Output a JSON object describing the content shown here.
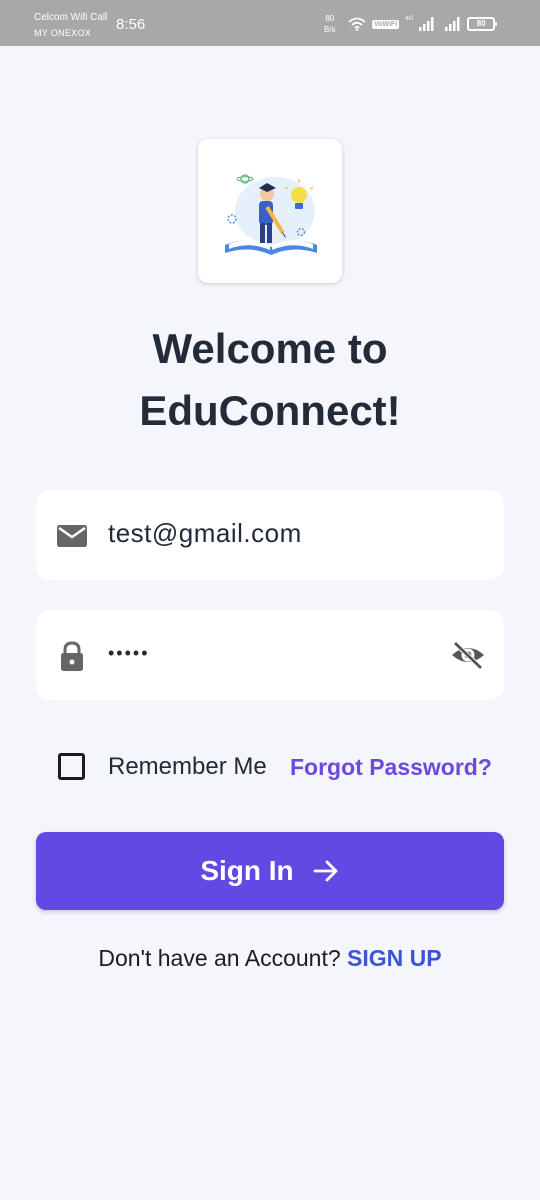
{
  "status_bar": {
    "carrier_line1": "Celcom Wifi Call",
    "carrier_line2": "MY ONEXOX",
    "time": "8:56",
    "net_speed_value": "80",
    "net_speed_unit": "B/s",
    "vowifi_label": "VoWiFi",
    "lte_label": "4G",
    "battery_level": "80"
  },
  "welcome": {
    "line1": "Welcome to",
    "line2": "EduConnect!"
  },
  "email": {
    "value": "test@gmail.com",
    "icon": "mail-icon"
  },
  "password": {
    "value": "•••••",
    "icon": "lock-icon",
    "toggle_icon": "eye-off-icon"
  },
  "remember": {
    "label": "Remember Me",
    "checked": false
  },
  "forgot_password_label": "Forgot Password?",
  "signin": {
    "label": "Sign In",
    "icon": "arrow-right-icon"
  },
  "signup": {
    "prompt": "Don't have an Account?",
    "link": "SIGN UP"
  },
  "colors": {
    "background": "#f4f6fb",
    "primary": "#6448e4",
    "forgot_link": "#6c49e0",
    "signup_link": "#3a55d6",
    "heading": "#232b38"
  }
}
